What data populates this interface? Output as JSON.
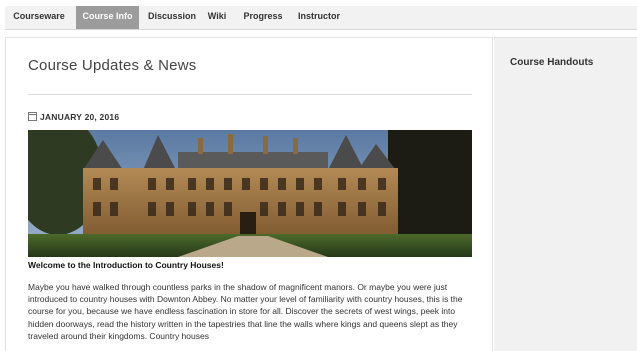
{
  "nav": {
    "tabs": [
      {
        "label": "Courseware",
        "active": false
      },
      {
        "label": "Course Info",
        "active": true
      },
      {
        "label": "Discussion",
        "active": false
      },
      {
        "label": "Wiki",
        "active": false
      },
      {
        "label": "Progress",
        "active": false
      },
      {
        "label": "Instructor",
        "active": false
      }
    ]
  },
  "main": {
    "title": "Course Updates & News",
    "update": {
      "date": "JANUARY 20, 2016",
      "heading": "Welcome to the Introduction to Country Houses!",
      "paragraph": "Maybe you have walked through countless parks in the shadow of magnificent manors. Or maybe you were just introduced to country houses with Downton Abbey. No matter your level of familiarity with country houses, this is the course for you, because we have endless fascination in store for all. Discover the secrets of west wings, peek into hidden doorways, read the history written in the tapestries that line the walls where kings and queens slept as they traveled around their kingdoms. Country houses"
    }
  },
  "sidebar": {
    "title": "Course Handouts"
  }
}
